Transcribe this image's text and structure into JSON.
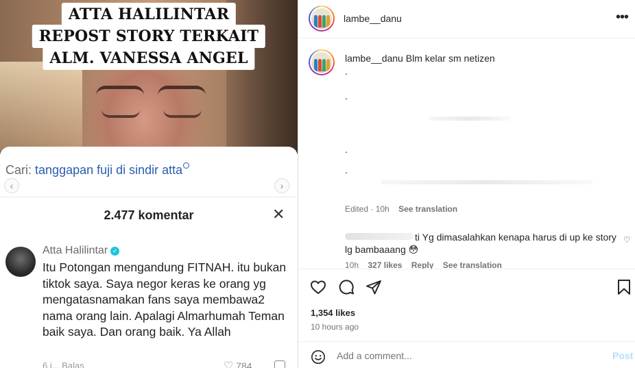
{
  "media": {
    "caption_lines": [
      "ATTA HALILINTAR",
      "REPOST STORY TERKAIT",
      "ALM. VANESSA ANGEL"
    ],
    "search_prefix": "Cari:",
    "search_term": "tanggapan fuji di sindir atta",
    "comment_count": "2.477 komentar",
    "close_glyph": "✕",
    "comment": {
      "author": "Atta Halilintar",
      "text": "Itu Potongan mengandung FITNAH. itu bukan tiktok saya. Saya negor keras ke orang yg mengatasnamakan fans saya membawa2 nama orang lain. Apalagi Almarhumah Teman baik saya. Dan orang baik. Ya Allah",
      "meta": "6 j... Balas",
      "likes": "784"
    }
  },
  "post": {
    "username": "lambe__danu",
    "more_glyph": "•••",
    "caption_user": "lambe__danu",
    "caption_text": "Blm kelar sm netizen",
    "dots": [
      ".",
      ".",
      ".",
      "."
    ],
    "caption_edited": "Edited · 10h",
    "see_translation": "See translation",
    "comment": {
      "text": "ti Yg dimasalahkan kenapa harus di up ke story lg bambaaang 😳",
      "time": "10h",
      "likes": "327 likes",
      "reply": "Reply",
      "see_translation": "See translation"
    },
    "like_count": "1,354 likes",
    "time_ago": "10 hours ago",
    "add_comment_placeholder": "Add a comment...",
    "post_label": "Post"
  },
  "icons": {
    "like": "heart-icon",
    "comment": "comment-icon",
    "share": "share-icon",
    "save": "bookmark-icon",
    "emoji": "emoji-icon",
    "verified": "verified-icon"
  },
  "colors": {
    "link_blue": "#2a5db0",
    "post_disabled": "#b2dffc",
    "verified": "#20c5d8",
    "muted": "#737373"
  }
}
